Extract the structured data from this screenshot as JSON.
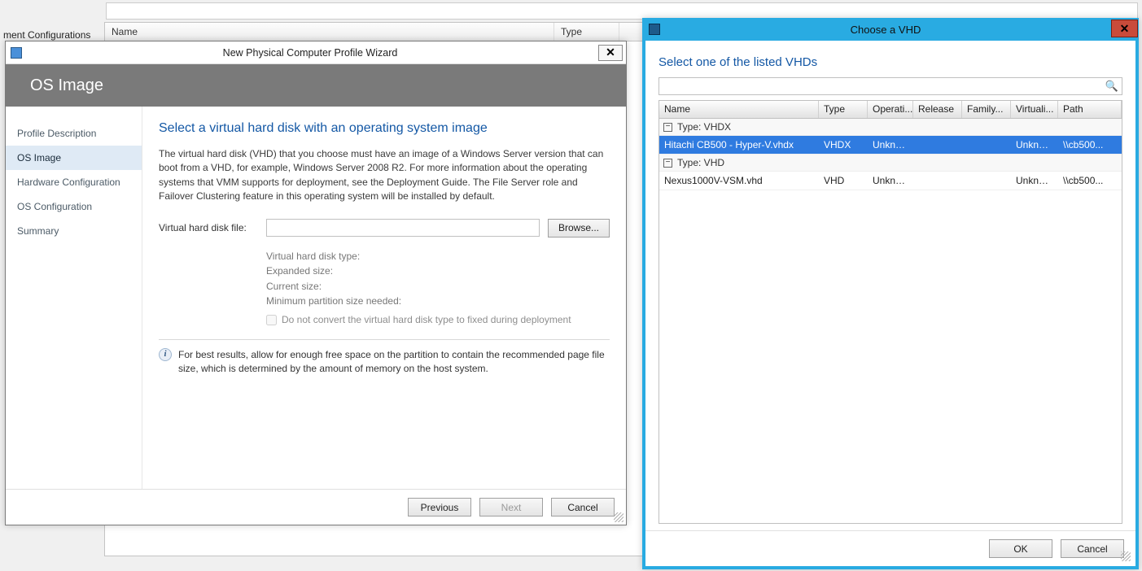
{
  "bg": {
    "leftLabel": "ment Configurations",
    "cols": {
      "name": "Name",
      "type": "Type"
    }
  },
  "wizard": {
    "title": "New Physical Computer Profile Wizard",
    "banner": "OS Image",
    "nav": [
      {
        "label": "Profile Description"
      },
      {
        "label": "OS Image"
      },
      {
        "label": "Hardware Configuration"
      },
      {
        "label": "OS Configuration"
      },
      {
        "label": "Summary"
      }
    ],
    "heading": "Select a virtual hard disk with an operating system image",
    "paragraph": "The virtual hard disk (VHD) that you choose must have an image of a Windows Server version that can boot from a VHD, for example, Windows Server 2008 R2. For more information about the operating systems that VMM supports for deployment, see the Deployment Guide. The File Server role and Failover Clustering feature in this operating system will be installed by default.",
    "field": {
      "label": "Virtual hard disk file:",
      "value": "",
      "browse": "Browse..."
    },
    "details": {
      "type": "Virtual hard disk type:",
      "exp": "Expanded size:",
      "cur": "Current size:",
      "min": "Minimum partition size needed:",
      "chk": "Do not convert the virtual hard disk type to fixed during deployment"
    },
    "info": "For best results, allow for enough free space on the partition to contain the recommended page file size, which is determined by the amount of memory on the host system.",
    "buttons": {
      "prev": "Previous",
      "next": "Next",
      "cancel": "Cancel"
    }
  },
  "chooser": {
    "title": "Choose a VHD",
    "heading": "Select one of the listed VHDs",
    "searchPlaceholder": "",
    "cols": {
      "name": "Name",
      "type": "Type",
      "os": "Operati...",
      "rel": "Release",
      "fam": "Family...",
      "virt": "Virtuali...",
      "path": "Path"
    },
    "groups": [
      {
        "label": "Type:  VHDX",
        "rows": [
          {
            "name": "Hitachi CB500 - Hyper-V.vhdx",
            "type": "VHDX",
            "os": "Unknown",
            "rel": "",
            "fam": "",
            "virt": "Unknown",
            "path": "\\\\cb500...",
            "selected": true
          }
        ]
      },
      {
        "label": "Type:  VHD",
        "rows": [
          {
            "name": "Nexus1000V-VSM.vhd",
            "type": "VHD",
            "os": "Unknown",
            "rel": "",
            "fam": "",
            "virt": "Unknown",
            "path": "\\\\cb500...",
            "selected": false
          }
        ]
      }
    ],
    "buttons": {
      "ok": "OK",
      "cancel": "Cancel"
    }
  }
}
